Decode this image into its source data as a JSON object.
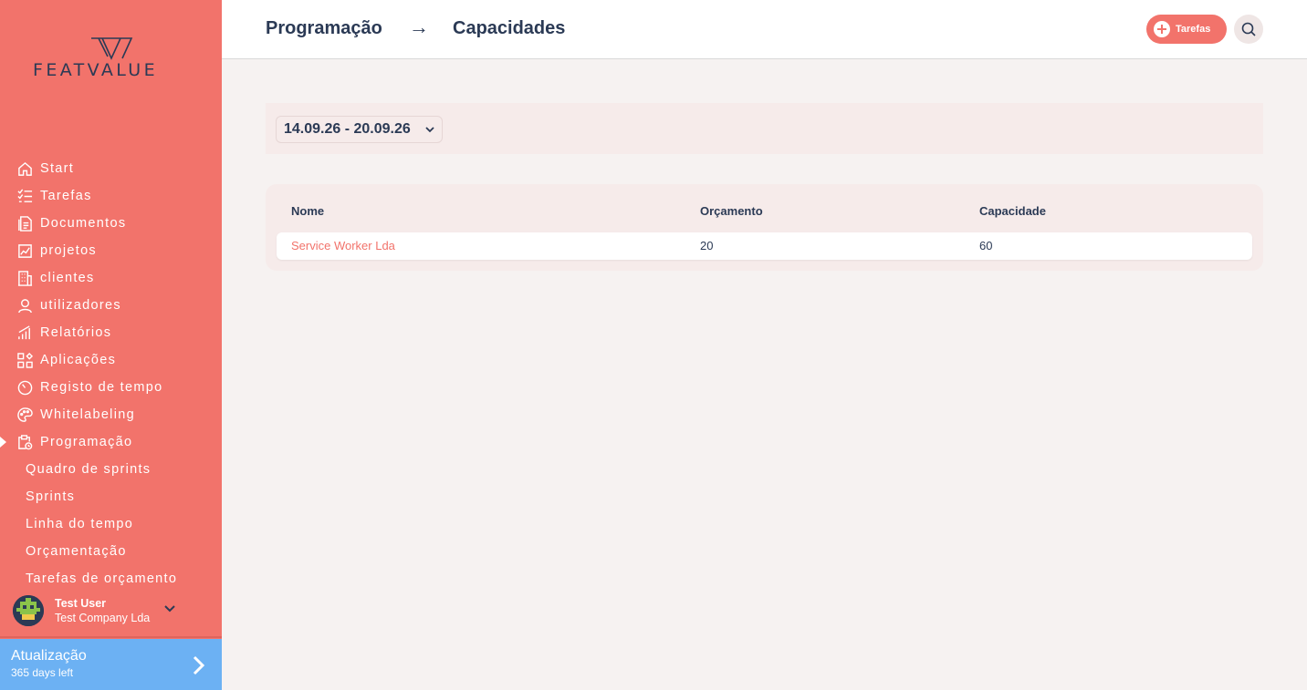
{
  "brand": {
    "name": "FEATVALUE"
  },
  "sidebar": {
    "items": [
      {
        "label": "Start",
        "icon": "home-icon"
      },
      {
        "label": "Tarefas",
        "icon": "task-list-icon"
      },
      {
        "label": "Documentos",
        "icon": "documents-icon"
      },
      {
        "label": "projetos",
        "icon": "projects-chart-icon"
      },
      {
        "label": "clientes",
        "icon": "building-icon"
      },
      {
        "label": "utilizadores",
        "icon": "user-icon"
      },
      {
        "label": "Relatórios",
        "icon": "reports-bars-icon"
      },
      {
        "label": "Aplicações",
        "icon": "apps-grid-icon"
      },
      {
        "label": "Registo de tempo",
        "icon": "timer-icon"
      },
      {
        "label": "Whitelabeling",
        "icon": "palette-icon"
      },
      {
        "label": "Programação",
        "icon": "clipboard-clock-icon",
        "active": true
      }
    ],
    "subitems": [
      {
        "label": "Quadro de sprints"
      },
      {
        "label": "Sprints"
      },
      {
        "label": "Linha do tempo"
      },
      {
        "label": "Orçamentação"
      },
      {
        "label": "Tarefas de orçamento"
      }
    ],
    "user": {
      "name": "Test User",
      "company": "Test Company Lda"
    },
    "upgrade": {
      "title": "Atualização",
      "days_left": "365 days left"
    }
  },
  "header": {
    "breadcrumb": [
      "Programação",
      "Capacidades"
    ],
    "arrow": "→",
    "tasks_button": "Tarefas"
  },
  "filter": {
    "date_range": "14.09.26 - 20.09.26"
  },
  "table": {
    "columns": [
      "Nome",
      "Orçamento",
      "Capacidade"
    ],
    "rows": [
      {
        "name": "Service Worker Lda",
        "budget": "20",
        "capacity": "60"
      }
    ]
  },
  "colors": {
    "accent": "#f2736b",
    "navy": "#2b3a55",
    "upgrade": "#6cb1f3",
    "panel": "#f6ebea"
  }
}
